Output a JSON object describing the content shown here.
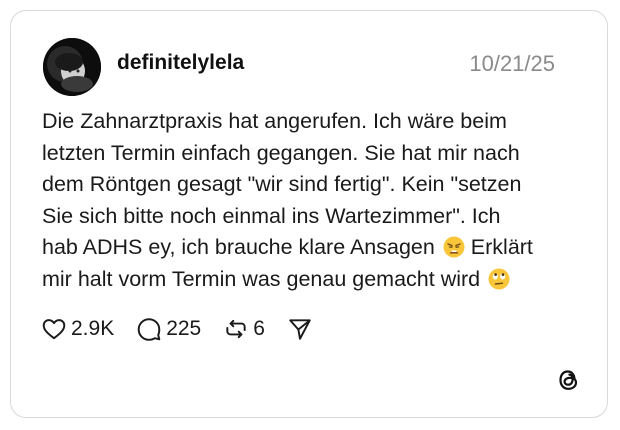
{
  "post": {
    "username": "definitelylela",
    "date": "10/21/25",
    "text_part1": "Die Zahnarztpraxis hat angerufen. Ich wäre beim\nletzten Termin einfach gegangen. Sie hat mir nach\ndem Röntgen gesagt \"wir sind fertig\". Kein \"setzen\nSie sich bitte noch einmal ins Wartezimmer\". Ich\nhab ADHS ey, ich brauche klare Ansagen",
    "text_part2": " Erklärt\nmir halt vorm Termin was genau gemacht wird",
    "emoji_1": "weary-face-emoji",
    "emoji_2": "eye-roll-emoji"
  },
  "actions": {
    "likes": "2.9K",
    "replies": "225",
    "reposts": "6",
    "like_icon": "heart-icon",
    "reply_icon": "comment-icon",
    "repost_icon": "repost-icon",
    "share_icon": "send-icon"
  },
  "branding": {
    "logo": "threads-logo-icon"
  }
}
